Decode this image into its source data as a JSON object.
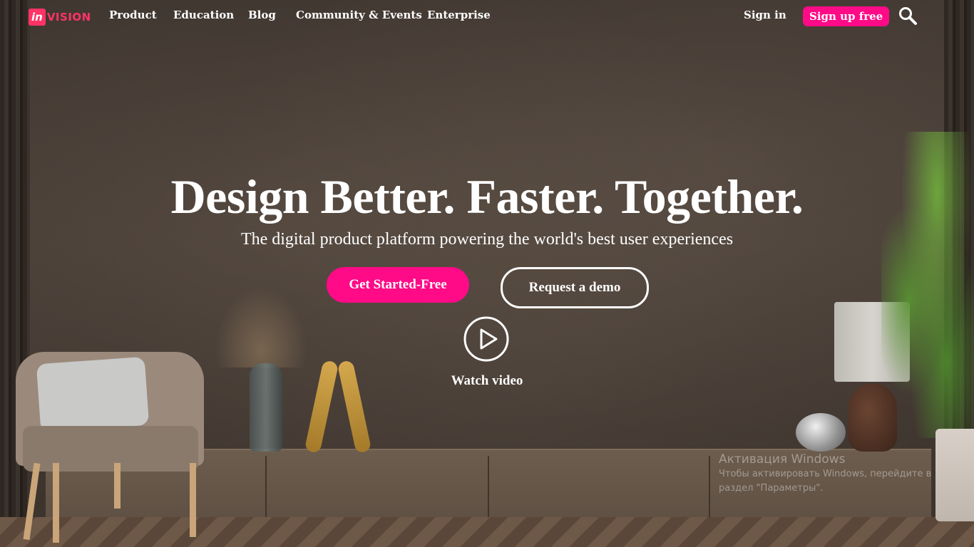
{
  "nav": {
    "logo": {
      "mark": "in",
      "word": "VISION"
    },
    "links": [
      "Product",
      "Education",
      "Blog",
      "Community & Events",
      "Enterprise"
    ],
    "signin_label": "Sign in",
    "signup_label": "Sign up free",
    "search_icon": "search-icon"
  },
  "hero": {
    "title": "Design Better. Faster. Together.",
    "subtitle": "The digital product platform powering the world's best user experiences",
    "primary_cta": "Get Started-Free",
    "secondary_cta": "Request a demo",
    "video_label": "Watch video",
    "play_icon": "play-icon"
  },
  "watermark": {
    "title": "Активация Windows",
    "line1": "Чтобы активировать Windows, перейдите в",
    "line2": "раздел \"Параметры\"."
  },
  "colors": {
    "accent": "#ff0a87",
    "logo": "#ff3366",
    "text": "#ffffff"
  }
}
